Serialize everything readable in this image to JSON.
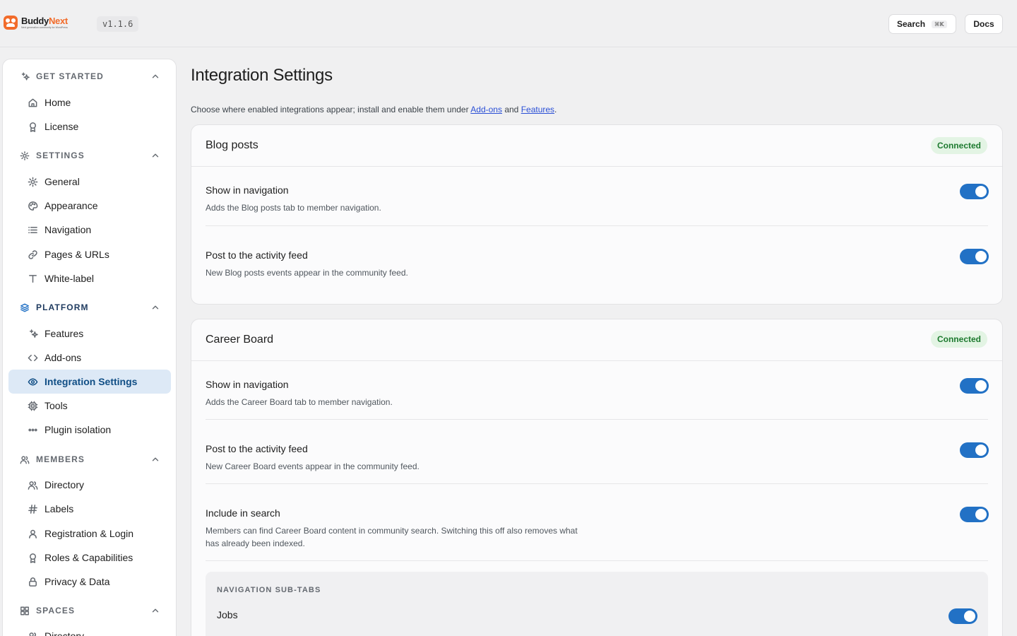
{
  "app": {
    "brand_name_part1": "Buddy",
    "brand_name_part2": "Next",
    "brand_tagline": "Next generation community for WordPress",
    "version": "v1.1.6"
  },
  "header": {
    "search_label": "Search",
    "search_shortcut": "⌘K",
    "docs_label": "Docs"
  },
  "sidebar": {
    "sections": [
      {
        "label": "GET STARTED",
        "icon": "sparkle-icon",
        "items": [
          {
            "label": "Home",
            "icon": "home-icon"
          },
          {
            "label": "License",
            "icon": "award-icon"
          }
        ]
      },
      {
        "label": "SETTINGS",
        "icon": "gear-icon",
        "items": [
          {
            "label": "General",
            "icon": "gear-icon"
          },
          {
            "label": "Appearance",
            "icon": "palette-icon"
          },
          {
            "label": "Navigation",
            "icon": "list-icon"
          },
          {
            "label": "Pages & URLs",
            "icon": "link-icon"
          },
          {
            "label": "White-label",
            "icon": "type-icon"
          }
        ]
      },
      {
        "label": "PLATFORM",
        "icon": "layers-icon",
        "items": [
          {
            "label": "Features",
            "icon": "sparkle-icon"
          },
          {
            "label": "Add-ons",
            "icon": "code-icon"
          },
          {
            "label": "Integration Settings",
            "icon": "eye-icon",
            "active": true
          },
          {
            "label": "Tools",
            "icon": "cpu-icon"
          },
          {
            "label": "Plugin isolation",
            "icon": "dots-icon"
          }
        ]
      },
      {
        "label": "MEMBERS",
        "icon": "users-icon",
        "items": [
          {
            "label": "Directory",
            "icon": "users-icon"
          },
          {
            "label": "Labels",
            "icon": "hash-icon"
          },
          {
            "label": "Registration & Login",
            "icon": "user-icon"
          },
          {
            "label": "Roles & Capabilities",
            "icon": "award-icon"
          },
          {
            "label": "Privacy & Data",
            "icon": "lock-icon"
          }
        ]
      },
      {
        "label": "SPACES",
        "icon": "grid-icon",
        "items": [
          {
            "label": "Directory",
            "icon": "users-icon"
          }
        ]
      }
    ]
  },
  "main": {
    "title": "Integration Settings",
    "intro_prefix": "Choose where enabled integrations appear; install and enable them under ",
    "intro_link1": "Add-ons",
    "intro_mid": " and ",
    "intro_link2": "Features",
    "intro_suffix": ".",
    "cards": [
      {
        "title": "Blog posts",
        "status": "Connected",
        "rows": [
          {
            "title": "Show in navigation",
            "desc": "Adds the Blog posts tab to member navigation.",
            "enabled": true
          },
          {
            "title": "Post to the activity feed",
            "desc": "New Blog posts events appear in the community feed.",
            "enabled": true
          }
        ]
      },
      {
        "title": "Career Board",
        "status": "Connected",
        "rows": [
          {
            "title": "Show in navigation",
            "desc": "Adds the Career Board tab to member navigation.",
            "enabled": true
          },
          {
            "title": "Post to the activity feed",
            "desc": "New Career Board events appear in the community feed.",
            "enabled": true
          },
          {
            "title": "Include in search",
            "desc": "Members can find Career Board content in community search. Switching this off also removes what has already been indexed.",
            "enabled": true
          }
        ],
        "subtabs": {
          "label": "NAVIGATION SUB-TABS",
          "items": [
            {
              "label": "Jobs",
              "enabled": true
            }
          ]
        }
      }
    ]
  },
  "colors": {
    "accent": "#2271c5",
    "brand": "#f26b2a",
    "active_bg": "#dde9f6",
    "badge_bg": "#e3f4e4",
    "badge_text": "#1d7a2f"
  }
}
